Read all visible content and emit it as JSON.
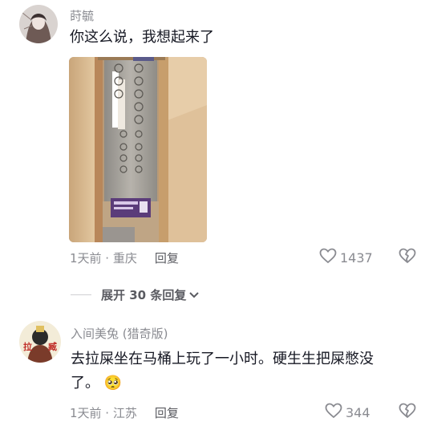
{
  "comments": [
    {
      "username": "莳毓",
      "text": "你这么说，我想起来了",
      "has_image": true,
      "image_description_icon": "elevator-photo",
      "meta": "1天前 · 重庆",
      "reply_label": "回复",
      "likes": "1437"
    },
    {
      "username": "入间美兔 (猎奇版)",
      "text_line1": "去拉屎坐在马桶上玩了一小时。硬生生把屎憋没",
      "text_line2": "了。",
      "emoji": "🥺",
      "meta": "1天前 · 江苏",
      "reply_label": "回复",
      "likes": "344"
    }
  ],
  "expand_replies": "展开 30 条回复",
  "colors": {
    "text_primary": "#161823",
    "text_secondary": "#8a8b91",
    "icon": "#8a8b91"
  }
}
